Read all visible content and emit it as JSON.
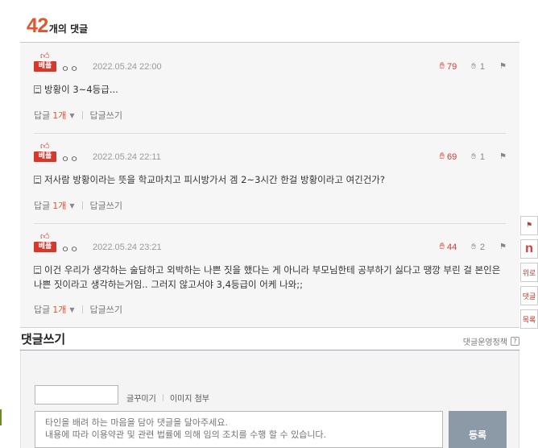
{
  "header": {
    "count": "42",
    "count_label": "개의 댓글"
  },
  "badge_label": "베플",
  "comments": [
    {
      "author": "ㅇㅇ",
      "date": "2022.05.24 22:00",
      "likes": "79",
      "dislikes": "1",
      "text": "방황이 3~4등급...",
      "reply_label": "답글",
      "reply_count": "1개",
      "write_reply": "답글쓰기"
    },
    {
      "author": "ㅇㅇ",
      "date": "2022.05.24 22:11",
      "likes": "69",
      "dislikes": "1",
      "text": "저사람 방황이라는 뜻을 학교마치고 피시방가서 겜 2~3시간 한걸 방황이라고 여긴건가?",
      "reply_label": "답글",
      "reply_count": "1개",
      "write_reply": "답글쓰기"
    },
    {
      "author": "ㅇㅇ",
      "date": "2022.05.24 23:21",
      "likes": "44",
      "dislikes": "2",
      "text": "이건 우리가 생각하는 술담하고 외박하는 나쁜 짓을 했다는 게 아니라 부모님한테 공부하기 싫다고 땡깡 부린 걸 본인은 나쁜 짓이라고 생각하는거임.. 그러지 않고서야 3,4등급이 어케 나와;;",
      "reply_label": "답글",
      "reply_count": "1개",
      "write_reply": "답글쓰기"
    }
  ],
  "side_tools": {
    "reply": "위로",
    "comments": "댓글",
    "list": "목록"
  },
  "write": {
    "title": "댓글쓰기",
    "policy": "댓글운영정책",
    "policy_q": "?",
    "nickname_value": "",
    "decorate": "글꾸미기",
    "attach_image": "이미지 첨부",
    "placeholder": "타인을 배려 하는 마음을 담아 댓글을 달아주세요.\n내용에 따라 이용약관 및 관련 법률에 의해 임의 조치를 수행 할 수 있습니다.",
    "submit": "등록"
  },
  "colors": {
    "accent": "#e2552f",
    "like": "#d8382b",
    "submit_bg": "#8c9aa8"
  }
}
